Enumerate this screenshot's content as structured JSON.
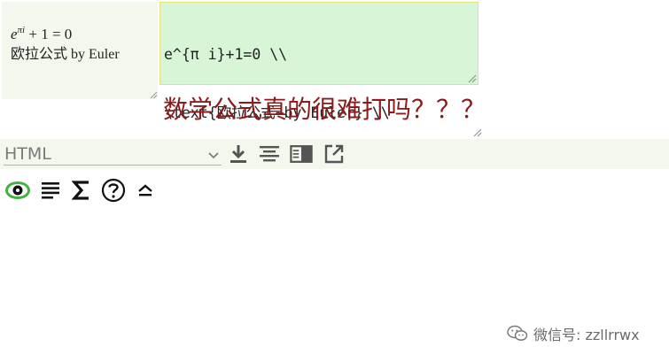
{
  "preview": {
    "equation_base": "e",
    "equation_superscript": "πi",
    "equation_rest": " + 1 = 0",
    "caption": "欧拉公式 by Euler"
  },
  "editor": {
    "lines": [
      "e^{π i}+1=0 \\\\",
      "\\text{欧拉公式~by Euler} \\\\"
    ]
  },
  "annotation": {
    "text": "数学公式真的很难打吗？？？"
  },
  "toolbar": {
    "format_selected": "HTML",
    "icons": [
      "download-icon",
      "align-center-icon",
      "reader-icon",
      "open-external-icon"
    ]
  },
  "iconrow": {
    "icons": [
      "eye-icon",
      "list-icon",
      "sigma-icon",
      "help-icon",
      "collapse-icon"
    ]
  },
  "watermark": {
    "text": "微信号: zzllrrwx"
  },
  "colors": {
    "editor_bg": "#d8f5d8",
    "preview_bg": "#f3f7ee",
    "annotation": "#8b1a1a",
    "eye_accent": "#3fb53f"
  }
}
